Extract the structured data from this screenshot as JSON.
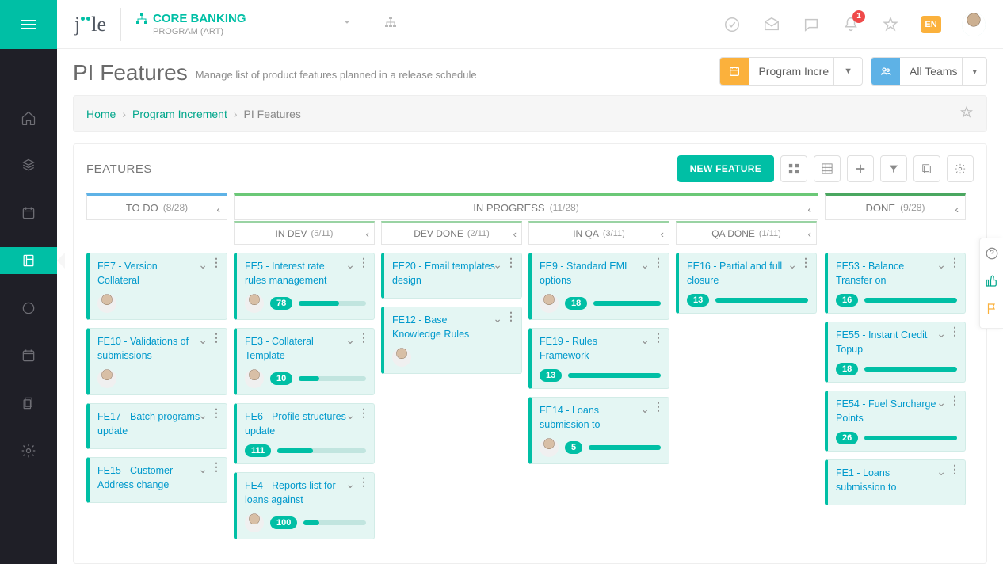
{
  "header": {
    "logo": "jile",
    "program_label": "CORE BANKING",
    "program_sub": "PROGRAM (ART)",
    "notif_count": "1",
    "lang": "EN"
  },
  "page": {
    "title": "PI Features",
    "subtitle": "Manage list of product features planned in a release schedule",
    "select1": "Program Incre",
    "select2": "All Teams",
    "crumb_home": "Home",
    "crumb_pi": "Program Increment",
    "crumb_cur": "PI Features",
    "features_heading": "FEATURES",
    "new_feature_btn": "NEW FEATURE"
  },
  "board": {
    "todo": {
      "label": "TO DO",
      "count": "(8/28)"
    },
    "inprogress": {
      "label": "IN PROGRESS",
      "count": "(11/28)"
    },
    "done": {
      "label": "DONE",
      "count": "(9/28)"
    },
    "sub": {
      "indev": {
        "label": "IN DEV",
        "count": "(5/11)"
      },
      "devdone": {
        "label": "DEV DONE",
        "count": "(2/11)"
      },
      "inqa": {
        "label": "IN QA",
        "count": "(3/11)"
      },
      "qadone": {
        "label": "QA DONE",
        "count": "(1/11)"
      }
    }
  },
  "cards": {
    "todo": [
      {
        "title": "FE7 - Version Collateral",
        "avatar": true
      },
      {
        "title": "FE10 - Validations of submissions",
        "avatar": true
      },
      {
        "title": "FE17 - Batch programs update"
      },
      {
        "title": "FE15 - Customer Address change"
      }
    ],
    "indev": [
      {
        "title": "FE5 - Interest rate rules management",
        "avatar": true,
        "pill": "78",
        "pct": 60
      },
      {
        "title": "FE3 - Collateral Template",
        "avatar": true,
        "pill": "10",
        "pct": 30
      },
      {
        "title": "FE6 - Profile structures update",
        "pill": "111",
        "pct": 40
      },
      {
        "title": "FE4 - Reports list for loans against",
        "avatar": true,
        "pill": "100",
        "pct": 25
      }
    ],
    "devdone": [
      {
        "title": "FE20 - Email templates design"
      },
      {
        "title": "FE12 - Base Knowledge Rules",
        "avatar": true
      }
    ],
    "inqa": [
      {
        "title": "FE9 - Standard EMI options",
        "avatar": true,
        "pill": "18",
        "pct": 100
      },
      {
        "title": "FE19 - Rules Framework",
        "pill": "13",
        "pct": 100
      },
      {
        "title": "FE14 - Loans submission to",
        "avatar": true,
        "pill": "5",
        "pct": 100
      }
    ],
    "qadone": [
      {
        "title": "FE16 - Partial and full closure",
        "pill": "13",
        "pct": 100
      }
    ],
    "done": [
      {
        "title": "FE53 - Balance Transfer on",
        "pill": "16",
        "pct": 100
      },
      {
        "title": "FE55 - Instant Credit Topup",
        "pill": "18",
        "pct": 100
      },
      {
        "title": "FE54 - Fuel Surcharge Points",
        "pill": "26",
        "pct": 100
      },
      {
        "title": "FE1 - Loans submission to"
      }
    ]
  }
}
